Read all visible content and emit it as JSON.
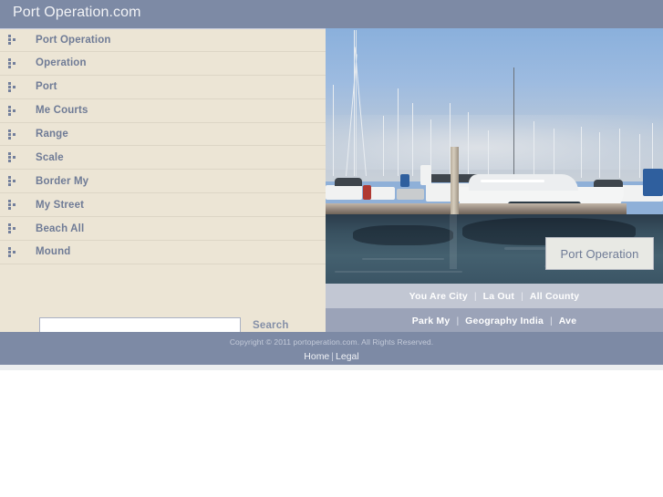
{
  "header": {
    "title": "Port Operation.com"
  },
  "sidebar": {
    "bullet_icon": "dots-bullet-icon",
    "items": [
      {
        "label": "Port Operation"
      },
      {
        "label": "Operation"
      },
      {
        "label": "Port"
      },
      {
        "label": "Me Courts"
      },
      {
        "label": "Range"
      },
      {
        "label": "Scale"
      },
      {
        "label": "Border My"
      },
      {
        "label": "My Street"
      },
      {
        "label": "Beach All"
      },
      {
        "label": "Mound"
      }
    ]
  },
  "search": {
    "value": "",
    "placeholder": "",
    "button_label": "Search"
  },
  "hero": {
    "caption": "Port Operation",
    "alt": "marina-photo-with-yachts-and-sailboat-masts"
  },
  "nav_primary": {
    "separator": "|",
    "items": [
      {
        "label": "You Are City"
      },
      {
        "label": "La Out"
      },
      {
        "label": "All County"
      }
    ]
  },
  "nav_secondary": {
    "separator": "|",
    "items": [
      {
        "label": "Park My"
      },
      {
        "label": "Geography India"
      },
      {
        "label": "Ave"
      }
    ]
  },
  "footer": {
    "copyright": "Copyright © 2011 portoperation.com. All Rights Reserved.",
    "separator": "|",
    "links": [
      {
        "label": "Home"
      },
      {
        "label": "Legal"
      }
    ]
  },
  "colors": {
    "header_bar": "#7d8aa5",
    "sidebar_bg": "#ece5d5",
    "nav_primary_bg": "#c2c7d3",
    "nav_secondary_bg": "#9ba3b8",
    "footer_bg": "#7d8aa5",
    "link_text": "#6f7b96",
    "caption_bg": "#e8e9e4"
  }
}
